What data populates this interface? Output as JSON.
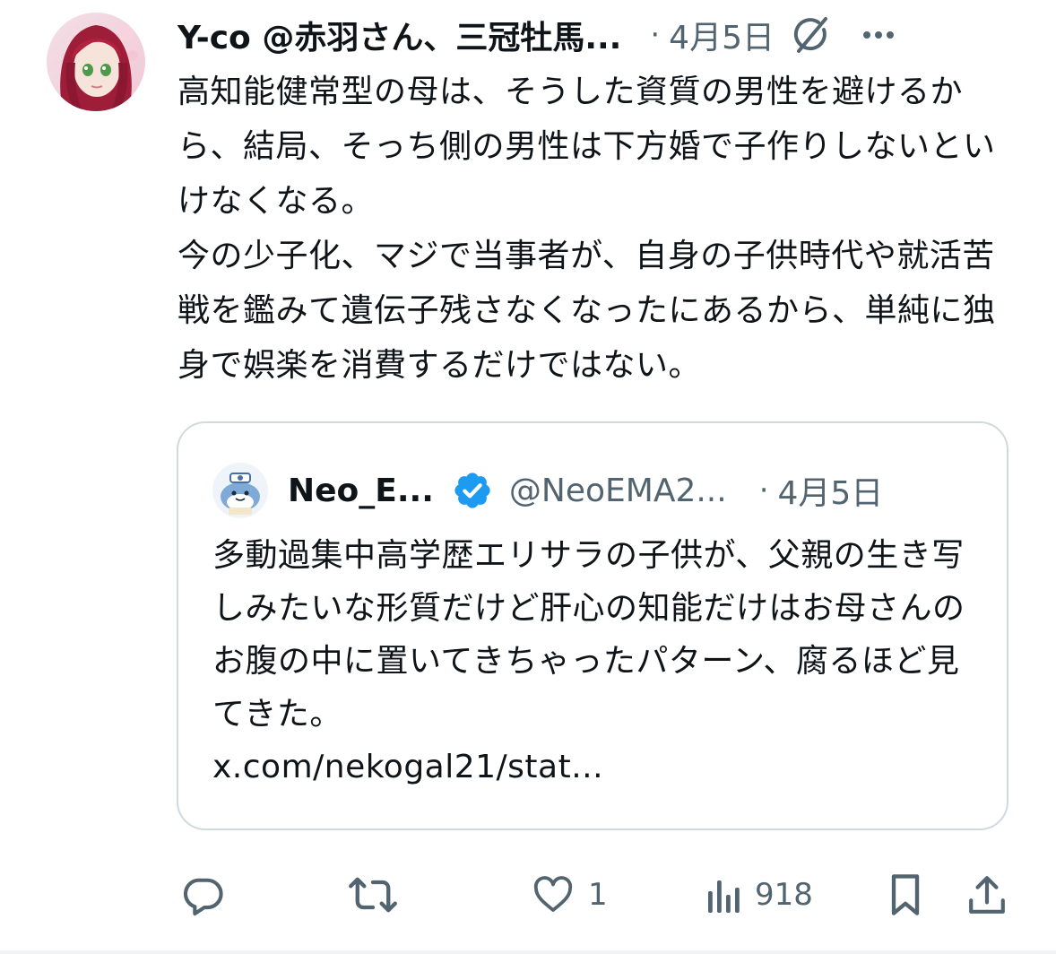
{
  "tweet": {
    "display_name": "Y-co @赤羽さん、三冠牡馬...",
    "timestamp": "4月5日",
    "separator": "·",
    "body_paragraphs": [
      "高知能健常型の母は、そうした資質の男性を避けるから、結局、そっち側の男性は下方婚で子作りしないといけなくなる。",
      "今の少子化、マジで当事者が、自身の子供時代や就活苦戦を鑑みて遺伝子残さなくなったにあるから、単純に独身で娯楽を消費するだけではない。"
    ]
  },
  "quote": {
    "display_name": "Neo_E...",
    "verified": true,
    "handle": "@NeoEMA2...",
    "separator": "·",
    "timestamp": "4月5日",
    "body": "多動過集中高学歴エリサラの子供が、父親の生き写しみたいな形質だけど肝心の知能だけはお母さんのお腹の中に置いてきちゃったパターン、腐るほど見てきた。",
    "link": "x.com/nekogal21/stat..."
  },
  "actions": {
    "reply_count": "",
    "repost_count": "",
    "like_count": "1",
    "views_count": "918"
  },
  "icons": {
    "grok": "grok-icon",
    "more": "more-icon",
    "reply": "reply-icon",
    "repost": "repost-icon",
    "like": "heart-icon",
    "views": "views-icon",
    "bookmark": "bookmark-icon",
    "share": "share-icon",
    "verified": "verified-badge-icon"
  },
  "colors": {
    "text": "#0f1419",
    "secondary": "#536471",
    "border": "#cfd9de",
    "verified": "#1d9bf0"
  }
}
